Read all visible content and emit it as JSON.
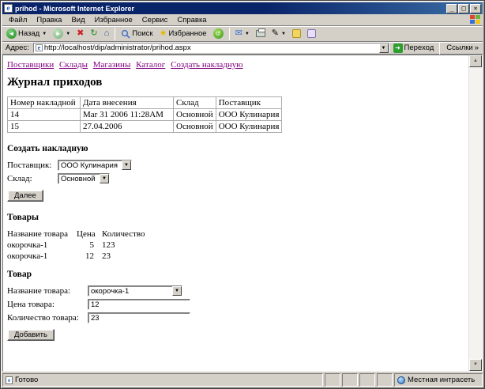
{
  "window": {
    "title": "prihod - Microsoft Internet Explorer",
    "menu": {
      "file": "Файл",
      "edit": "Правка",
      "view": "Вид",
      "favorites": "Избранное",
      "tools": "Сервис",
      "help": "Справка"
    },
    "controls": {
      "minimize": "_",
      "maximize": "□",
      "close": "×"
    },
    "toolbar": {
      "back_label": "Назад",
      "search_label": "Поиск",
      "favorites_label": "Избранное"
    },
    "address": {
      "label": "Адрес:",
      "url": "http://localhost/dip/administrator/prihod.aspx",
      "go_label": "Переход",
      "links_label": "Ссылки"
    },
    "status": {
      "ready": "Готово",
      "zone": "Местная интрасеть"
    }
  },
  "icons": {
    "back": "◄",
    "forward": "►",
    "stop": "✖",
    "refresh": "↻",
    "home": "⌂",
    "search": "🔍",
    "star": "★",
    "history": "↺",
    "mail": "✉",
    "edit": "✎",
    "dropdown": "▼",
    "go": "➜",
    "chevron": "»",
    "up": "▲",
    "down": "▼",
    "ie": "e"
  },
  "colors": {
    "titlebar": "#0a246a",
    "chrome": "#d4d0c8",
    "link_visited": "#800080",
    "go_green": "#2e9e2e",
    "back_green": "#1d8a1d",
    "table_border": "#ababab"
  },
  "page": {
    "nav_links": [
      {
        "label": "Поставщики"
      },
      {
        "label": "Склады"
      },
      {
        "label": "Магазины"
      },
      {
        "label": "Каталог"
      },
      {
        "label": "Создать накладную"
      }
    ],
    "title": "Журнал приходов",
    "journal_table": {
      "headers": [
        "Номер накладной",
        "Дата внесения",
        "Склад",
        "Поставщик"
      ],
      "rows": [
        [
          "14",
          "Mar 31 2006 11:28AM",
          "Основной",
          "ООО Кулинария"
        ],
        [
          "15",
          "27.04.2006",
          "Основной",
          "ООО Кулинария"
        ]
      ]
    },
    "create_invoice": {
      "title": "Создать накладную",
      "supplier_label": "Поставщик:",
      "supplier_value": "ООО Кулинария",
      "warehouse_label": "Склад:",
      "warehouse_value": "Основной",
      "next_button": "Далее"
    },
    "products": {
      "title": "Товары",
      "headers": [
        "Название товара",
        "Цена",
        "Количество"
      ],
      "rows": [
        [
          "окорочка-1",
          "5",
          "123"
        ],
        [
          "окорочка-1",
          "12",
          "23"
        ]
      ]
    },
    "product_form": {
      "title": "Товар",
      "name_label": "Название товара:",
      "name_value": "окорочка-1",
      "price_label": "Цена товара:",
      "price_value": "12",
      "qty_label": "Количество товара:",
      "qty_value": "23",
      "add_button": "Добавить"
    }
  }
}
